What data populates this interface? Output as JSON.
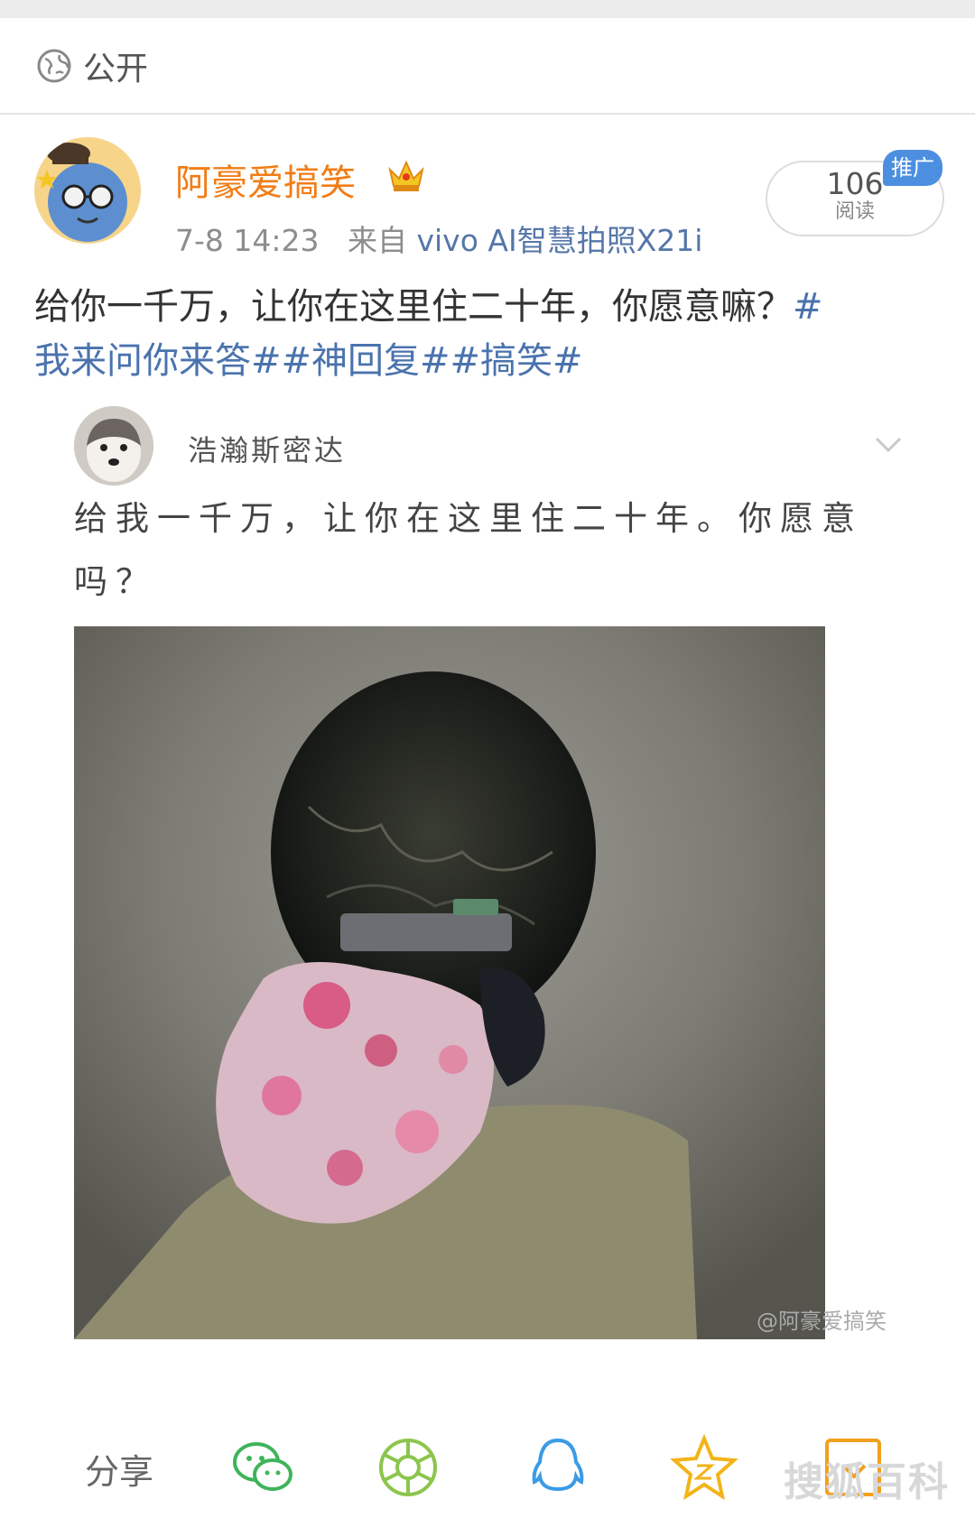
{
  "visibility": {
    "label": "公开",
    "icon": "globe-icon"
  },
  "post": {
    "username": "阿豪爱搞笑",
    "badge_icon": "crown-icon",
    "time": "7-8 14:23",
    "source_prefix": "来自",
    "source": "vivo AI智慧拍照X21i",
    "reads_count": "106",
    "reads_label": "阅读",
    "ad_label": "推广",
    "caption_text": "给你一千万，让你在这里住二十年，你愿意嘛？",
    "caption_tags_1": "#",
    "caption_tags_2": "我来问你来答##神回复##搞笑#"
  },
  "embedded": {
    "username": "浩瀚斯密达",
    "text": "给我一千万，让你在这里住二十年。你愿意吗？",
    "watermark": "@阿豪爱搞笑"
  },
  "share_bar": {
    "label": "分享",
    "icons": [
      "wechat-icon",
      "moments-icon",
      "qq-icon",
      "qzone-icon",
      "favorite-icon"
    ],
    "site_mark": "搜狐百科"
  }
}
